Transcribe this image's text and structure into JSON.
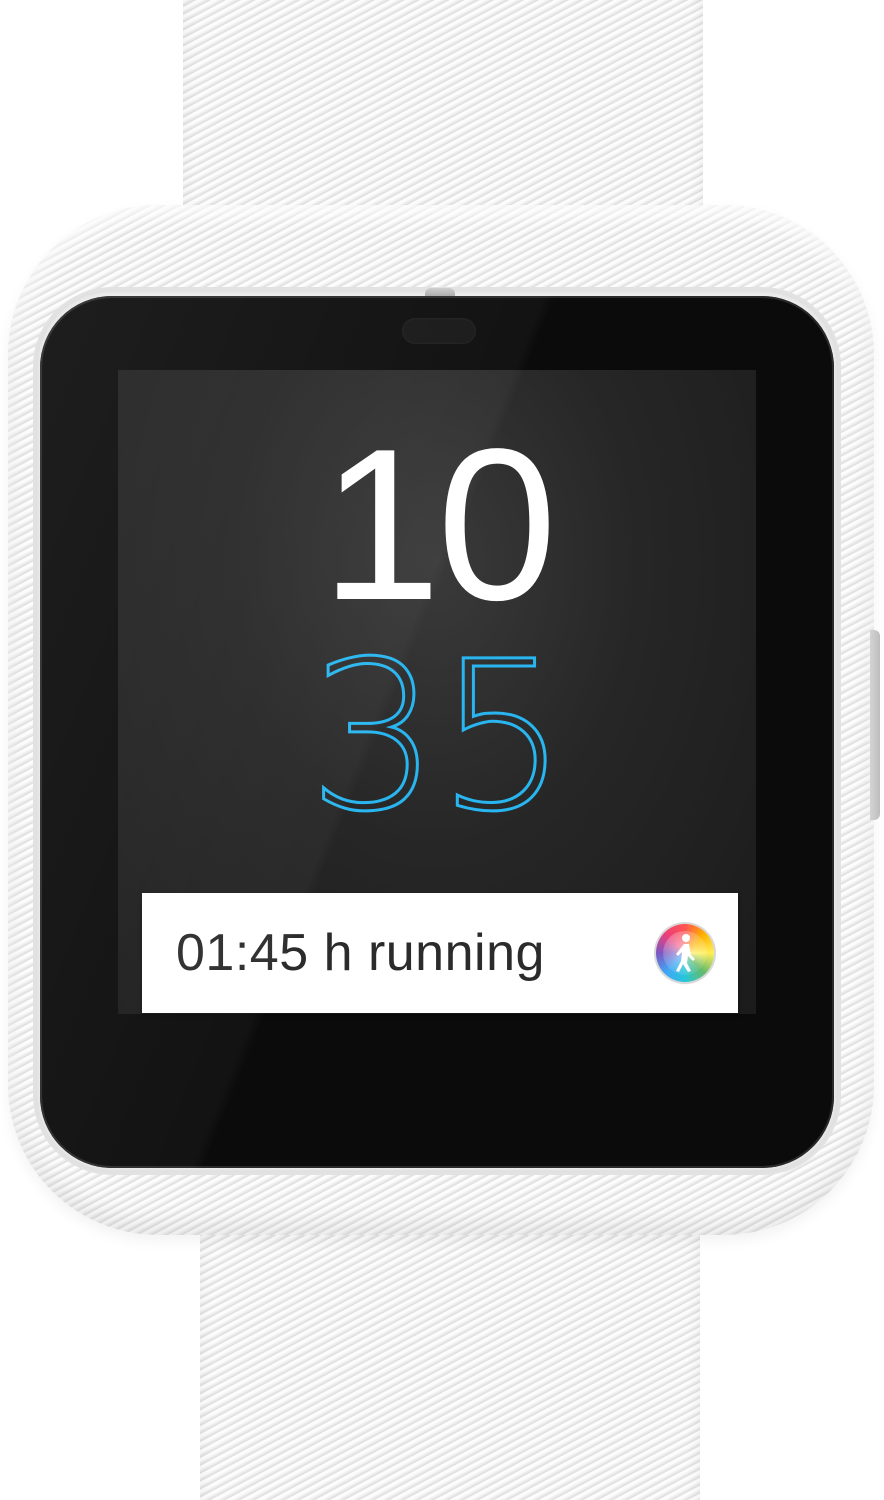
{
  "watch": {
    "color": "#f1f1f1",
    "time": {
      "hours": "10",
      "minutes": "35",
      "hours_color": "#ffffff",
      "minutes_color": "#29b6f0"
    },
    "notification": {
      "text": "01:45 h running",
      "icon": "activity-app-icon"
    }
  }
}
